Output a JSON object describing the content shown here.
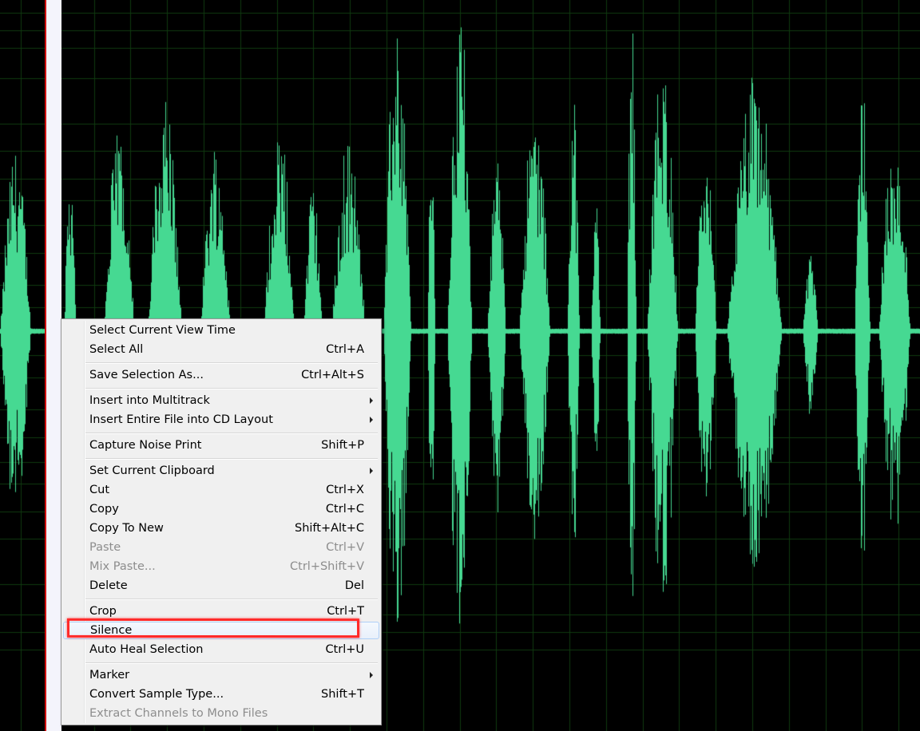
{
  "colors": {
    "waveform": "#46d992",
    "grid": "#0f3a0f",
    "background": "#000000",
    "selection": "#f4f4fc",
    "cursor": "#d01010",
    "highlight_box": "#ff2a2a"
  },
  "context_menu": {
    "groups": [
      [
        {
          "label": "Select Current View Time",
          "shortcut": ""
        },
        {
          "label": "Select All",
          "shortcut": "Ctrl+A"
        }
      ],
      [
        {
          "label": "Save Selection As...",
          "shortcut": "Ctrl+Alt+S"
        }
      ],
      [
        {
          "label": "Insert into Multitrack",
          "shortcut": "",
          "submenu": true
        },
        {
          "label": "Insert Entire File into CD Layout",
          "shortcut": "",
          "submenu": true
        }
      ],
      [
        {
          "label": "Capture Noise Print",
          "shortcut": "Shift+P"
        }
      ],
      [
        {
          "label": "Set Current Clipboard",
          "shortcut": "",
          "submenu": true
        },
        {
          "label": "Cut",
          "shortcut": "Ctrl+X"
        },
        {
          "label": "Copy",
          "shortcut": "Ctrl+C"
        },
        {
          "label": "Copy To New",
          "shortcut": "Shift+Alt+C"
        },
        {
          "label": "Paste",
          "shortcut": "Ctrl+V",
          "disabled": true
        },
        {
          "label": "Mix Paste...",
          "shortcut": "Ctrl+Shift+V",
          "disabled": true
        },
        {
          "label": "Delete",
          "shortcut": "Del"
        }
      ],
      [
        {
          "label": "Crop",
          "shortcut": "Ctrl+T"
        },
        {
          "label": "Silence",
          "shortcut": "",
          "highlighted": true
        },
        {
          "label": "Auto Heal Selection",
          "shortcut": "Ctrl+U"
        }
      ],
      [
        {
          "label": "Marker",
          "shortcut": "",
          "submenu": true
        },
        {
          "label": "Convert Sample Type...",
          "shortcut": "Shift+T"
        },
        {
          "label": "Extract Channels to Mono Files",
          "shortcut": "",
          "disabled": true
        }
      ]
    ]
  }
}
